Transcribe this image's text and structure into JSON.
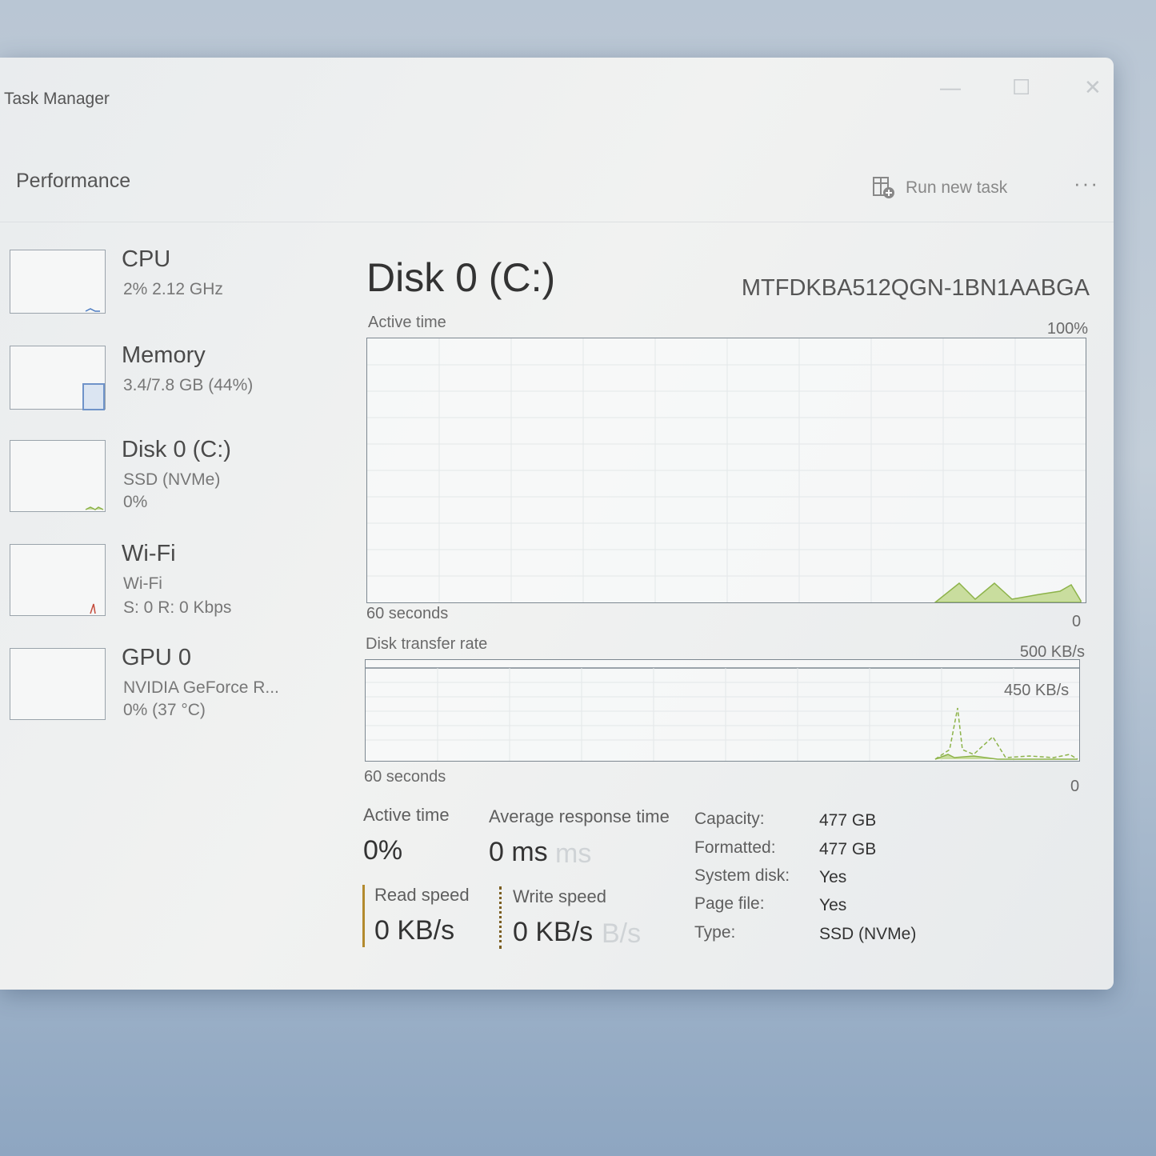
{
  "window": {
    "title": "Task Manager"
  },
  "header": {
    "section": "Performance",
    "run_new_task": "Run new task",
    "more": "···"
  },
  "sidebar": {
    "items": [
      {
        "name": "CPU",
        "lines": [
          "2% 2.12 GHz"
        ]
      },
      {
        "name": "Memory",
        "lines": [
          "3.4/7.8 GB (44%)"
        ]
      },
      {
        "name": "Disk 0 (C:)",
        "lines": [
          "SSD (NVMe)",
          "0%"
        ]
      },
      {
        "name": "Wi-Fi",
        "lines": [
          "Wi-Fi",
          "S: 0 R: 0 Kbps"
        ]
      },
      {
        "name": "GPU 0",
        "lines": [
          "NVIDIA GeForce R...",
          "0% (37 °C)"
        ]
      }
    ]
  },
  "main": {
    "title": "Disk 0 (C:)",
    "model": "MTFDKBA512QGN-1BN1AABGA",
    "active_graph": {
      "label": "Active time",
      "max": "100%",
      "time": "60 seconds",
      "min": "0"
    },
    "transfer_graph": {
      "label": "Disk transfer rate",
      "max": "500 KB/s",
      "inner": "450 KB/s",
      "time": "60 seconds",
      "min": "0"
    },
    "stats": {
      "active_time_label": "Active time",
      "active_time_value": "0%",
      "avg_response_label": "Average response time",
      "avg_response_value": "0 ms",
      "avg_response_ghost": "ms",
      "read_label": "Read speed",
      "read_value": "0 KB/s",
      "write_label": "Write speed",
      "write_value": "0 KB/s",
      "write_ghost": "B/s"
    },
    "properties": [
      {
        "key": "Capacity:",
        "value": "477 GB"
      },
      {
        "key": "Formatted:",
        "value": "477 GB"
      },
      {
        "key": "System disk:",
        "value": "Yes"
      },
      {
        "key": "Page file:",
        "value": "Yes"
      },
      {
        "key": "Type:",
        "value": "SSD (NVMe)"
      }
    ]
  },
  "colors": {
    "disk_accent": "#8db34a",
    "disk_fill": "#c9dd9e",
    "memory_accent": "#6f93c9",
    "wifi_accent": "#c44c3c"
  }
}
